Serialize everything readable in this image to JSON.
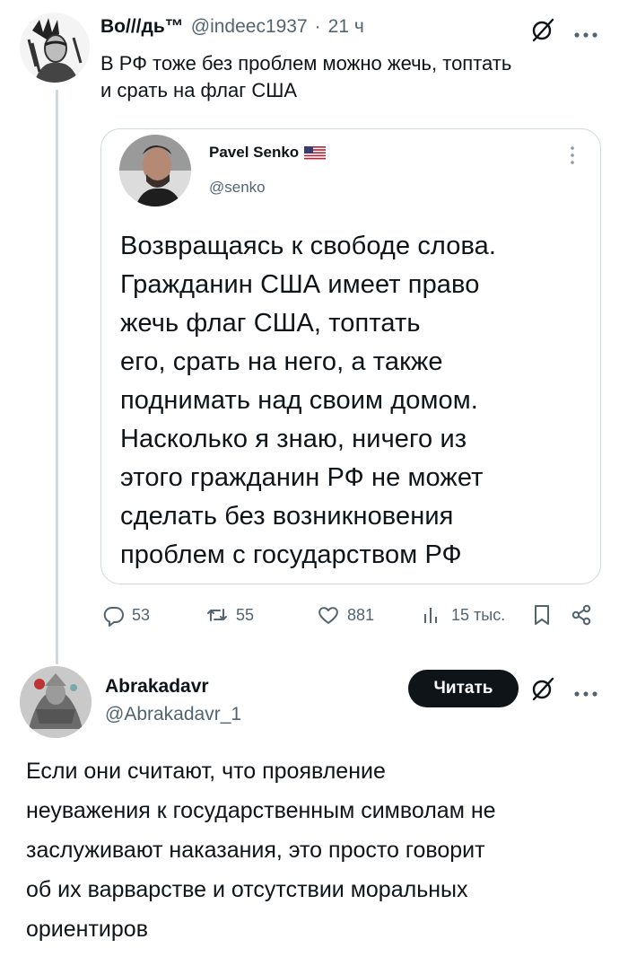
{
  "tweet": {
    "author_name": "Во///дь™",
    "handle": "@indeec1937",
    "separator": "·",
    "time": "21 ч",
    "text_lines": [
      "В РФ тоже без проблем можно жечь, топтать",
      "и срать на флаг США"
    ],
    "icons": {
      "grok": "slashed-circle-icon",
      "more": "more-dots-icon"
    },
    "quote": {
      "author_name": "Pavel Senko",
      "flag": "us-flag-icon",
      "handle": "@senko",
      "more": "vertical-dots-icon",
      "body_lines": [
        "Возвращаясь к свободе слова.",
        "Гражданин США имеет право",
        "жечь флаг США, топтать",
        "его, срать на него, а также",
        "поднимать над своим домом.",
        "Насколько я знаю, ничего из",
        "этого гражданин РФ не может",
        "сделать без возникновения",
        "проблем с государством РФ"
      ]
    },
    "actions": {
      "replies": "53",
      "retweets": "55",
      "likes": "881",
      "views": "15 тыс.",
      "icons": [
        "reply-icon",
        "retweet-icon",
        "like-icon",
        "views-icon",
        "bookmark-icon",
        "share-icon"
      ]
    }
  },
  "reply": {
    "author_name": "Abrakadavr",
    "handle": "@Abrakadavr_1",
    "follow_label": "Читать",
    "text_lines": [
      "Если они считают, что проявление",
      "неуважения к государственным символам не",
      "заслуживают наказания, это просто говорит",
      "об их варварстве и отсутствии моральных",
      "ориентиров"
    ]
  },
  "colors": {
    "text": "#0f1419",
    "muted": "#536471",
    "border": "#cfd9de",
    "button": "#0f1419"
  }
}
